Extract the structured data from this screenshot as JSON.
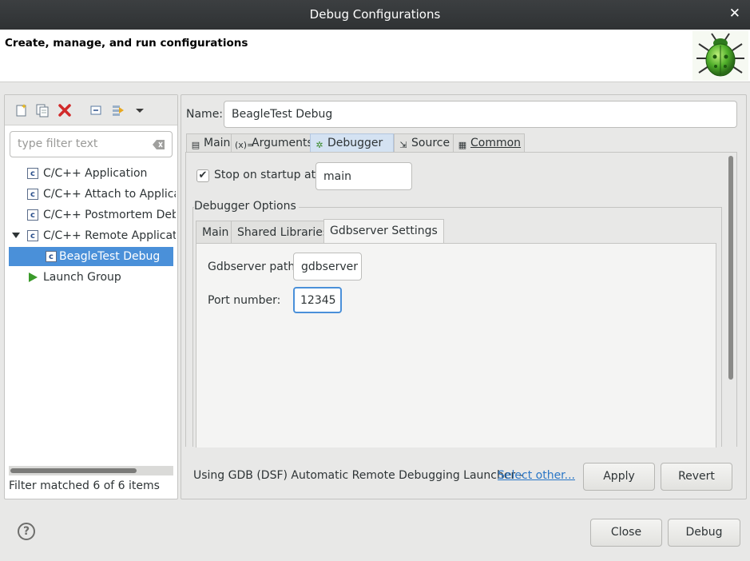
{
  "window": {
    "title": "Debug Configurations",
    "close_glyph": "✕"
  },
  "header": {
    "text": "Create, manage, and run configurations",
    "icon": "bug-icon"
  },
  "left": {
    "toolbar_icons": [
      "new-config-icon",
      "duplicate-icon",
      "delete-icon",
      "collapse-all-icon",
      "filter-icon",
      "dropdown-arrow-icon"
    ],
    "filter_placeholder": "type filter text",
    "tree": [
      {
        "label": "C/C++ Application",
        "icon": "c-app-icon"
      },
      {
        "label": "C/C++ Attach to Applicati",
        "icon": "c-app-icon"
      },
      {
        "label": "C/C++ Postmortem Debu",
        "icon": "c-app-icon"
      },
      {
        "label": "C/C++ Remote Applicatio",
        "icon": "c-app-icon",
        "expanded": true
      },
      {
        "label": "BeagleTest Debug",
        "icon": "c-config-icon",
        "selected": true
      },
      {
        "label": "Launch Group",
        "icon": "launch-group-icon"
      }
    ],
    "status": "Filter matched 6 of 6 items"
  },
  "right": {
    "name_label": "Name:",
    "name_value": "BeagleTest Debug",
    "tabs": [
      {
        "label": "Main",
        "icon": "main-tab-icon"
      },
      {
        "label": "Arguments",
        "icon": "arguments-icon"
      },
      {
        "label": "Debugger",
        "icon": "debugger-bug-icon",
        "active": true
      },
      {
        "label": "Source",
        "icon": "source-icon"
      },
      {
        "label": "Common",
        "icon": "common-icon"
      }
    ],
    "debugger": {
      "stop_on_startup_label": "Stop on startup at:",
      "stop_on_startup_checked": true,
      "stop_on_startup_value": "main",
      "options_group_label": "Debugger Options",
      "subtabs": [
        "Main",
        "Shared Libraries",
        "Gdbserver Settings"
      ],
      "active_subtab": "Gdbserver Settings",
      "gdbserver_path_label": "Gdbserver path:",
      "gdbserver_path_value": "gdbserver",
      "port_label": "Port number:",
      "port_value": "12345"
    },
    "launcher_text": "Using GDB (DSF) Automatic Remote Debugging Launcher -",
    "select_other": "Select other...",
    "apply": "Apply",
    "revert": "Revert"
  },
  "footer": {
    "help": "?",
    "close": "Close",
    "debug": "Debug"
  },
  "colors": {
    "selection": "#4a90d9",
    "titlebar": "#2f3234",
    "link": "#2a76c6",
    "delete_icon": "#d12a2a"
  }
}
